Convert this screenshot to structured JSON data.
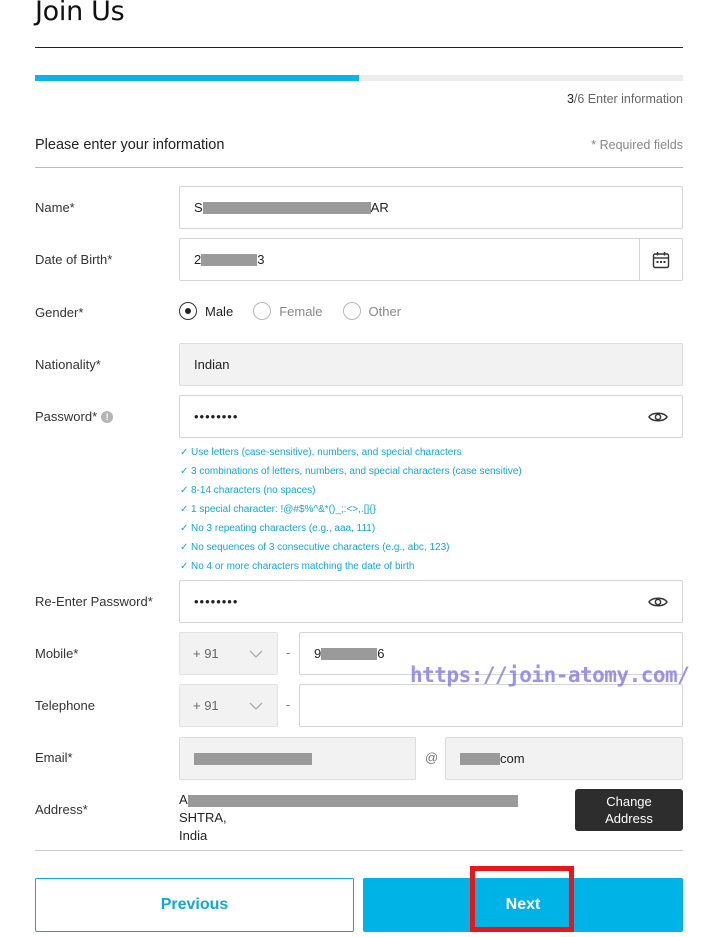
{
  "page": {
    "title": "Join Us"
  },
  "progress": {
    "fraction": 0.5,
    "step_current": "3",
    "step_rest": "/6 Enter information"
  },
  "section": {
    "title": "Please enter your information",
    "required_note": "* Required fields"
  },
  "name": {
    "label": "Name*",
    "prefix": "S",
    "suffix": "AR"
  },
  "dob": {
    "label": "Date of Birth*",
    "prefix": "2",
    "suffix": "3",
    "icon": "calendar-icon"
  },
  "gender": {
    "label": "Gender*",
    "options": [
      {
        "label": "Male",
        "selected": true
      },
      {
        "label": "Female",
        "selected": false
      },
      {
        "label": "Other",
        "selected": false
      }
    ]
  },
  "nationality": {
    "label": "Nationality*",
    "value": "Indian"
  },
  "password": {
    "label": "Password*",
    "value": "••••••••",
    "info_icon": "info-icon",
    "toggle_icon": "eye-icon",
    "rules": [
      "Use letters (case-sensitive), numbers, and special characters",
      "3 combinations of letters, numbers, and special characters (case sensitive)",
      "8-14 characters (no spaces)",
      "1 special character: !@#$%^&*()_;:<>,.[]{}",
      "No 3 repeating characters (e.g., aaa, 111)",
      "No sequences of 3 consecutive characters (e.g., abc, 123)",
      "No 4 or more characters matching the date of birth"
    ]
  },
  "reenter": {
    "label": "Re-Enter Password*",
    "value": "••••••••",
    "toggle_icon": "eye-icon"
  },
  "mobile": {
    "label": "Mobile*",
    "code": "+ 91",
    "dash": "-",
    "prefix": "9",
    "suffix": "6"
  },
  "telephone": {
    "label": "Telephone",
    "code": "+ 91",
    "dash": "-",
    "value": ""
  },
  "email": {
    "label": "Email*",
    "at": "@",
    "domain_suffix": "com"
  },
  "address": {
    "label": "Address*",
    "line_prefix": "A",
    "line_suffix": "SHTRA,",
    "line2": "India",
    "change_label": "Change\nAddress"
  },
  "buttons": {
    "previous": "Previous",
    "next": "Next"
  },
  "watermark": "https://join-atomy.com/",
  "colors": {
    "accent": "#00b3e6",
    "highlight": "#e8151b",
    "watermark": "#786ee6"
  }
}
